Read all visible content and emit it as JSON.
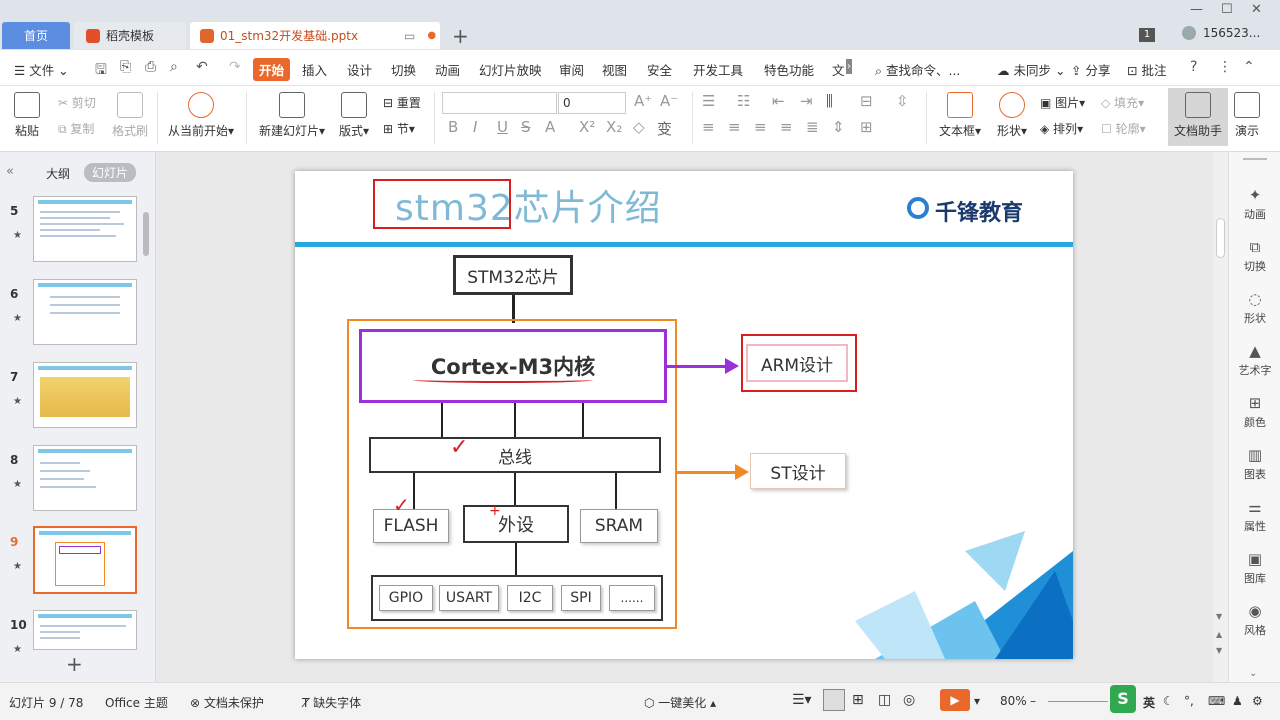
{
  "tabs": {
    "home": "首页",
    "template": "稻壳模板",
    "doc": "01_stm32开发基础.pptx"
  },
  "user": {
    "badge": "1",
    "id": "156523..."
  },
  "menu": {
    "file": "文件",
    "items": [
      "开始",
      "插入",
      "设计",
      "切换",
      "动画",
      "幻灯片放映",
      "审阅",
      "视图",
      "安全",
      "开发工具",
      "特色功能",
      "文"
    ],
    "search": "查找命令、...",
    "sync": "未同步",
    "share": "分享",
    "annotate": "批注"
  },
  "ribbon": {
    "paste": "粘贴",
    "cut": "剪切",
    "copy": "复制",
    "format_painter": "格式刷",
    "from_current": "从当前开始",
    "new_slide": "新建幻灯片",
    "layout": "版式",
    "reset": "重置",
    "section": "节",
    "font_size": "0",
    "textbox": "文本框",
    "shape": "形状",
    "picture": "图片",
    "arrange": "排列",
    "fill": "填充",
    "outline": "轮廓",
    "doc_helper": "文档助手",
    "present": "演示"
  },
  "leftpanel": {
    "outline_tab": "大纲",
    "slides_tab": "幻灯片",
    "slide_numbers": [
      "5",
      "6",
      "7",
      "8",
      "9",
      "10"
    ]
  },
  "slide": {
    "title": "stm32芯片介绍",
    "logo": "千锋教育",
    "chip": "STM32芯片",
    "core": "Cortex-M3内核",
    "arm": "ARM设计",
    "bus": "总线",
    "st": "ST设计",
    "flash": "FLASH",
    "periph": "外设",
    "sram": "SRAM",
    "gpio": "GPIO",
    "usart": "USART",
    "i2c": "I2C",
    "spi": "SPI",
    "more": "......",
    "colors": {
      "title": "#7fb9d6",
      "band": "#29a8e0",
      "core_border": "#9b30d9",
      "orange": "#f08a24",
      "annotation": "#d42020"
    }
  },
  "rightbar": [
    "动画",
    "切换",
    "形状",
    "艺术字",
    "颜色",
    "图表",
    "属性",
    "图库",
    "风格"
  ],
  "status": {
    "slide_count": "幻灯片 9 / 78",
    "theme": "Office 主题",
    "protect": "文档未保护",
    "font_missing": "缺失字体",
    "beautify": "一键美化",
    "zoom": "80%",
    "ime": "英"
  }
}
